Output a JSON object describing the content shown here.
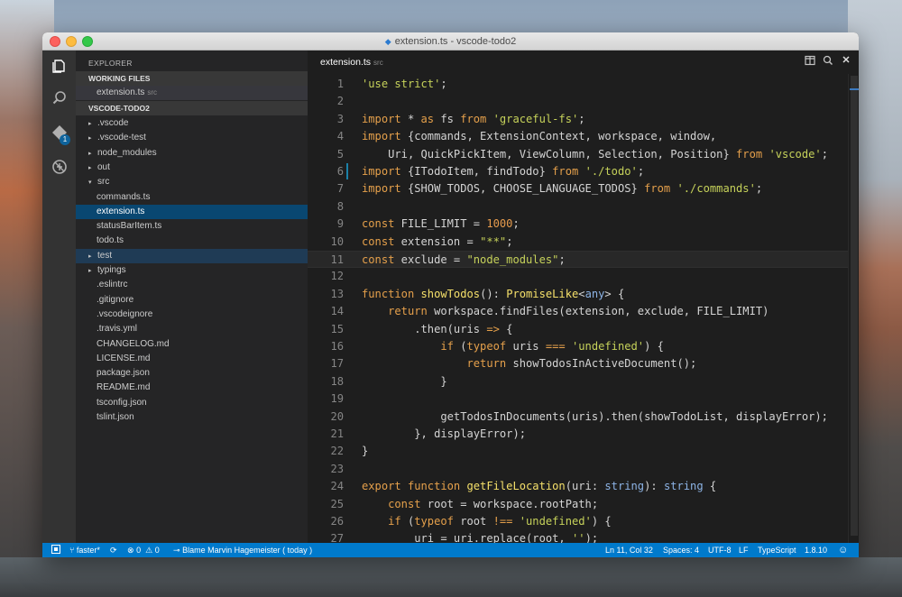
{
  "window": {
    "title": "extension.ts - vscode-todo2"
  },
  "activity": {
    "scm_badge": "1"
  },
  "sidebar": {
    "title": "EXPLORER",
    "working_files_header": "WORKING FILES",
    "working_files": [
      {
        "name": "extension.ts",
        "hint": "src"
      }
    ],
    "project_header": "VSCODE-TODO2",
    "tree": [
      {
        "label": ".vscode",
        "arrow": "▸"
      },
      {
        "label": ".vscode-test",
        "arrow": "▸"
      },
      {
        "label": "node_modules",
        "arrow": "▸"
      },
      {
        "label": "out",
        "arrow": "▸"
      },
      {
        "label": "src",
        "arrow": "▾"
      },
      {
        "label": "commands.ts",
        "arrow": ""
      },
      {
        "label": "extension.ts",
        "arrow": ""
      },
      {
        "label": "statusBarItem.ts",
        "arrow": ""
      },
      {
        "label": "todo.ts",
        "arrow": ""
      },
      {
        "label": "test",
        "arrow": "▸"
      },
      {
        "label": "typings",
        "arrow": "▸"
      },
      {
        "label": ".eslintrc",
        "arrow": ""
      },
      {
        "label": ".gitignore",
        "arrow": ""
      },
      {
        "label": ".vscodeignore",
        "arrow": ""
      },
      {
        "label": ".travis.yml",
        "arrow": ""
      },
      {
        "label": "CHANGELOG.md",
        "arrow": ""
      },
      {
        "label": "LICENSE.md",
        "arrow": ""
      },
      {
        "label": "package.json",
        "arrow": ""
      },
      {
        "label": "README.md",
        "arrow": ""
      },
      {
        "label": "tsconfig.json",
        "arrow": ""
      },
      {
        "label": "tslint.json",
        "arrow": ""
      }
    ]
  },
  "editor": {
    "tab": {
      "name": "extension.ts",
      "hint": "src"
    },
    "current_line": 11,
    "modified_line": 6,
    "lines": [
      [
        [
          "str",
          "'use strict'"
        ],
        [
          "",
          "; "
        ]
      ],
      [],
      [
        [
          "kw",
          "import"
        ],
        [
          "",
          " * "
        ],
        [
          "kw",
          "as"
        ],
        [
          "",
          " fs "
        ],
        [
          "kw",
          "from"
        ],
        [
          "",
          " "
        ],
        [
          "str",
          "'graceful-fs'"
        ],
        [
          "",
          ";"
        ]
      ],
      [
        [
          "kw",
          "import"
        ],
        [
          "",
          " {commands, ExtensionContext, workspace, window,"
        ]
      ],
      [
        [
          "",
          "    Uri, QuickPickItem, ViewColumn, Selection, Position} "
        ],
        [
          "kw",
          "from"
        ],
        [
          "",
          " "
        ],
        [
          "str",
          "'vscode'"
        ],
        [
          "",
          ";"
        ]
      ],
      [
        [
          "kw",
          "import"
        ],
        [
          "",
          " {ITodoItem, findTodo} "
        ],
        [
          "kw",
          "from"
        ],
        [
          "",
          " "
        ],
        [
          "str",
          "'./todo'"
        ],
        [
          "",
          ";"
        ]
      ],
      [
        [
          "kw",
          "import"
        ],
        [
          "",
          " {SHOW_TODOS, CHOOSE_LANGUAGE_TODOS} "
        ],
        [
          "kw",
          "from"
        ],
        [
          "",
          " "
        ],
        [
          "str",
          "'./commands'"
        ],
        [
          "",
          ";"
        ]
      ],
      [],
      [
        [
          "kw",
          "const"
        ],
        [
          "",
          " FILE_LIMIT = "
        ],
        [
          "num",
          "1000"
        ],
        [
          "",
          ";"
        ]
      ],
      [
        [
          "kw",
          "const"
        ],
        [
          "",
          " extension = "
        ],
        [
          "str",
          "\"**\""
        ],
        [
          "",
          ";"
        ]
      ],
      [
        [
          "kw",
          "const"
        ],
        [
          "",
          " exclude = "
        ],
        [
          "str",
          "\"node_modules\""
        ],
        [
          "",
          ";"
        ]
      ],
      [],
      [
        [
          "kw",
          "function"
        ],
        [
          "",
          " "
        ],
        [
          "fn",
          "showTodos"
        ],
        [
          "",
          "(): "
        ],
        [
          "fn",
          "PromiseLike"
        ],
        [
          "",
          "<"
        ],
        [
          "typ",
          "any"
        ],
        [
          "",
          "> {"
        ]
      ],
      [
        [
          "",
          "    "
        ],
        [
          "kw",
          "return"
        ],
        [
          "",
          " workspace.findFiles(extension, exclude, FILE_LIMIT)"
        ]
      ],
      [
        [
          "",
          "        .then(uris "
        ],
        [
          "kw",
          "=>"
        ],
        [
          "",
          " {"
        ]
      ],
      [
        [
          "",
          "            "
        ],
        [
          "kw",
          "if"
        ],
        [
          "",
          " ("
        ],
        [
          "kw",
          "typeof"
        ],
        [
          "",
          " uris "
        ],
        [
          "kw",
          "==="
        ],
        [
          "",
          " "
        ],
        [
          "str",
          "'undefined'"
        ],
        [
          "",
          ") {"
        ]
      ],
      [
        [
          "",
          "                "
        ],
        [
          "kw",
          "return"
        ],
        [
          "",
          " showTodosInActiveDocument();"
        ]
      ],
      [
        [
          "",
          "            }"
        ]
      ],
      [],
      [
        [
          "",
          "            getTodosInDocuments(uris).then(showTodoList, displayError);"
        ]
      ],
      [
        [
          "",
          "        }, displayError);"
        ]
      ],
      [
        [
          "",
          "}"
        ]
      ],
      [],
      [
        [
          "kw",
          "export"
        ],
        [
          "",
          " "
        ],
        [
          "kw",
          "function"
        ],
        [
          "",
          " "
        ],
        [
          "fn",
          "getFileLocation"
        ],
        [
          "",
          "(uri: "
        ],
        [
          "typ",
          "string"
        ],
        [
          "",
          "): "
        ],
        [
          "typ",
          "string"
        ],
        [
          "",
          " {"
        ]
      ],
      [
        [
          "",
          "    "
        ],
        [
          "kw",
          "const"
        ],
        [
          "",
          " root = workspace.rootPath;"
        ]
      ],
      [
        [
          "",
          "    "
        ],
        [
          "kw",
          "if"
        ],
        [
          "",
          " ("
        ],
        [
          "kw",
          "typeof"
        ],
        [
          "",
          " root "
        ],
        [
          "kw",
          "!=="
        ],
        [
          "",
          " "
        ],
        [
          "str",
          "'undefined'"
        ],
        [
          "",
          ") {"
        ]
      ],
      [
        [
          "",
          "        uri = uri.replace(root, "
        ],
        [
          "str",
          "''"
        ],
        [
          "",
          ");"
        ]
      ]
    ]
  },
  "status": {
    "branch": "faster*",
    "errors": "0",
    "warnings": "0",
    "blame": "Blame Marvin Hagemeister ( today )",
    "position": "Ln 11, Col 32",
    "indent": "Spaces: 4",
    "encoding": "UTF-8",
    "eol": "LF",
    "language": "TypeScript",
    "version": "1.8.10"
  }
}
